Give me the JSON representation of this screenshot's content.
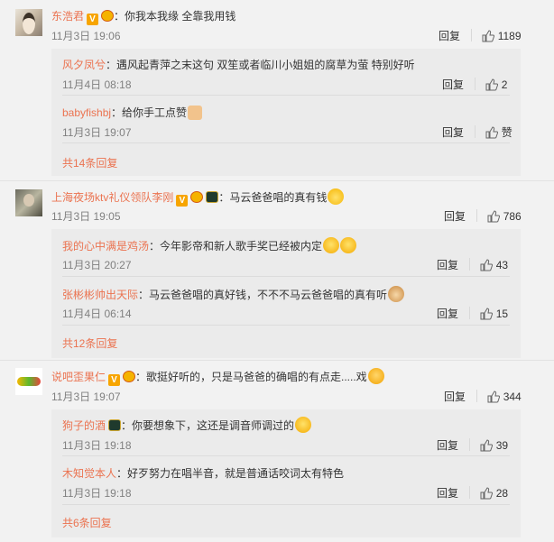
{
  "threads": [
    {
      "user": "东浩君",
      "text": "：你我本我缘 全靠我用钱",
      "time": "11月3日 19:06",
      "reply_label": "回复",
      "likes": "1189",
      "replies": [
        {
          "user": "风夕凤兮",
          "text": "：遇风起青萍之末这句 双笙或者临川小姐姐的腐草为萤 特别好听",
          "time": "11月4日 08:18",
          "reply_label": "回复",
          "likes": "2"
        },
        {
          "user": "babyfishbj",
          "text": "：给你手工点赞",
          "time": "11月3日 19:07",
          "reply_label": "回复",
          "likes": "赞"
        }
      ],
      "more": "共14条回复"
    },
    {
      "user": "上海夜场ktv礼仪领队李刚",
      "text": "：马云爸爸唱的真有钱",
      "time": "11月3日 19:05",
      "reply_label": "回复",
      "likes": "786",
      "replies": [
        {
          "user": "我的心中满是鸡汤",
          "text": "：今年影帝和新人歌手奖已经被内定",
          "time": "11月3日 20:27",
          "reply_label": "回复",
          "likes": "43"
        },
        {
          "user": "张彬彬帅出天际",
          "text": "：马云爸爸唱的真好钱，不不不马云爸爸唱的真有听",
          "time": "11月4日 06:14",
          "reply_label": "回复",
          "likes": "15"
        }
      ],
      "more": "共12条回复"
    },
    {
      "user": "说吧歪果仁",
      "text": "：歌挺好听的，只是马爸爸的确唱的有点走.....戏",
      "time": "11月3日 19:07",
      "reply_label": "回复",
      "likes": "344",
      "replies": [
        {
          "user": "狗子的酒",
          "text": "：你要想象下，这还是调音师调过的",
          "time": "11月3日 19:18",
          "reply_label": "回复",
          "likes": "39"
        },
        {
          "user": "木知觉本人",
          "text": "：好歹努力在唱半音，就是普通话咬词太有特色",
          "time": "11月3日 19:18",
          "reply_label": "回复",
          "likes": "28"
        }
      ],
      "more": "共6条回复"
    }
  ],
  "icons": {
    "like": "thumbs-up-icon",
    "vip": "verified-v-icon",
    "crown": "crown-badge-icon",
    "level": "level-badge-icon"
  },
  "colors": {
    "username": "#eb7350",
    "time": "#808080",
    "background": "#f2f2f2",
    "reply_box": "#ebebeb"
  }
}
